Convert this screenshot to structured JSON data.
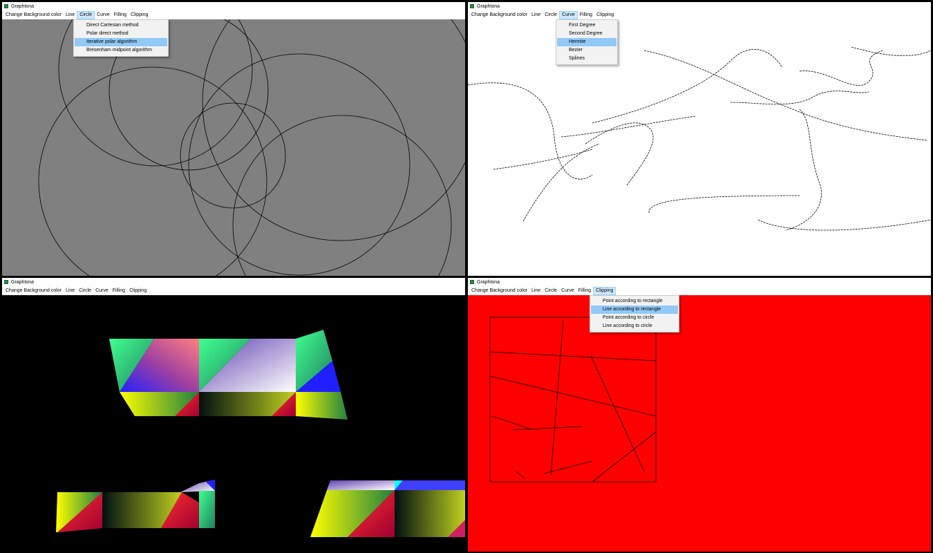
{
  "colors": {
    "gray_canvas": "#808080",
    "white_canvas": "#ffffff",
    "black_canvas": "#000000",
    "red_canvas": "#ff0000",
    "menu_highlight": "#91c9f7",
    "menu_open": "#cce8ff"
  },
  "windows": [
    {
      "title": "Graphtona",
      "icon": "app-icon",
      "menu": [
        "Change Background color",
        "Line",
        "Circle",
        "Curve",
        "Filling",
        "Clipping"
      ],
      "open_menu": "Circle",
      "dropdown": [
        "Direct Cartesian method",
        "Polar direct method",
        "Iterative polar algorithm",
        "Bresenham midpoint algorithm"
      ],
      "highlighted_item": "Iterative polar algorithm",
      "canvas_color": "#808080"
    },
    {
      "title": "Graphtona",
      "icon": "app-icon",
      "menu": [
        "Change Background color",
        "Line",
        "Circle",
        "Curve",
        "Filling",
        "Clipping"
      ],
      "open_menu": "Curve",
      "dropdown": [
        "First Degree",
        "Second Degree",
        "Hermite",
        "Bezier",
        "Splines"
      ],
      "highlighted_item": "Hermite",
      "canvas_color": "#ffffff"
    },
    {
      "title": "Graphtona",
      "icon": "app-icon",
      "menu": [
        "Change Background color",
        "Line",
        "Circle",
        "Curve",
        "Filling",
        "Clipping"
      ],
      "open_menu": "",
      "canvas_color": "#000000"
    },
    {
      "title": "Graphtona",
      "icon": "app-icon",
      "menu": [
        "Change Background color",
        "Line",
        "Circle",
        "Curve",
        "Filling",
        "Clipping"
      ],
      "open_menu": "Clipping",
      "dropdown": [
        "Point according to rectangle",
        "Line according to rectangle",
        "Point according to circle",
        "Line according to circle"
      ],
      "highlighted_item": "Line according to rectangle",
      "canvas_color": "#ff0000"
    }
  ]
}
